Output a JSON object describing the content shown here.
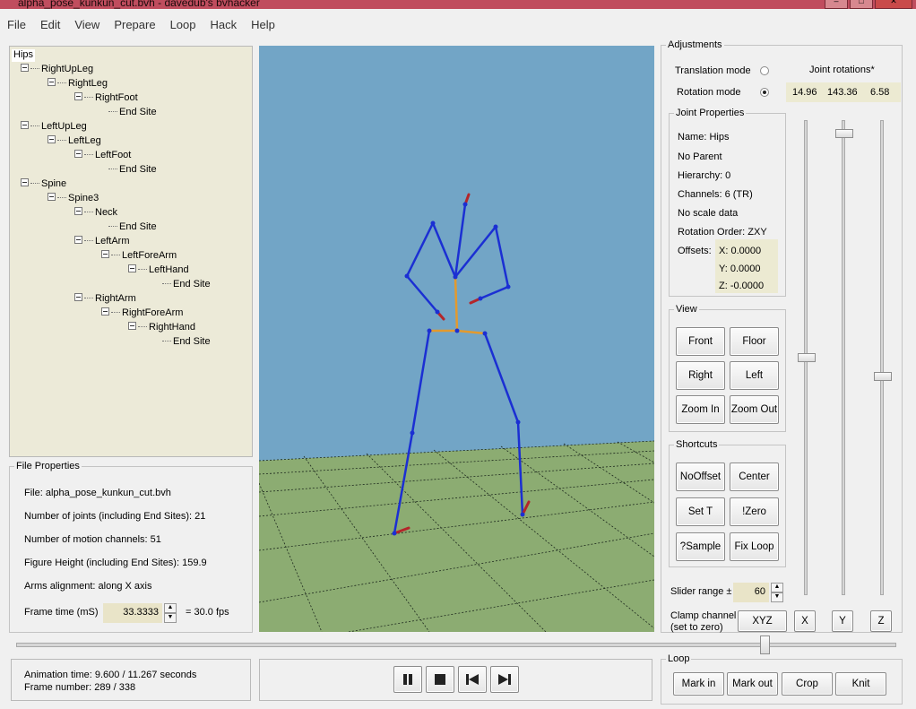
{
  "window": {
    "title": "alpha_pose_kunkun_cut.bvh - davedub's bvhacker"
  },
  "menu": [
    "File",
    "Edit",
    "View",
    "Prepare",
    "Loop",
    "Hack",
    "Help"
  ],
  "tree": [
    {
      "label": "Hips",
      "level": 0
    },
    {
      "label": "RightUpLeg",
      "level": 1
    },
    {
      "label": "RightLeg",
      "level": 2
    },
    {
      "label": "RightFoot",
      "level": 3
    },
    {
      "label": "End Site",
      "level": 4
    },
    {
      "label": "LeftUpLeg",
      "level": 1
    },
    {
      "label": "LeftLeg",
      "level": 2
    },
    {
      "label": "LeftFoot",
      "level": 3
    },
    {
      "label": "End Site",
      "level": 4
    },
    {
      "label": "Spine",
      "level": 1
    },
    {
      "label": "Spine3",
      "level": 2
    },
    {
      "label": "Neck",
      "level": 3
    },
    {
      "label": "End Site",
      "level": 4
    },
    {
      "label": "LeftArm",
      "level": 3
    },
    {
      "label": "LeftForeArm",
      "level": 4
    },
    {
      "label": "LeftHand",
      "level": 5
    },
    {
      "label": "End Site",
      "level": 6
    },
    {
      "label": "RightArm",
      "level": 3
    },
    {
      "label": "RightForeArm",
      "level": 4
    },
    {
      "label": "RightHand",
      "level": 5
    },
    {
      "label": "End Site",
      "level": 6
    }
  ],
  "file_props": {
    "legend": "File Properties",
    "file": "File: alpha_pose_kunkun_cut.bvh",
    "joints": "Number of joints (including End Sites): 21",
    "channels": "Number of motion channels: 51",
    "height": "Figure Height (including End Sites): 159.9",
    "arms": "Arms alignment: along X axis",
    "frame_time_label": "Frame time (mS)",
    "frame_time_value": "33.3333",
    "fps": "=  30.0 fps"
  },
  "adjustments": {
    "legend": "Adjustments",
    "translation_mode": "Translation mode",
    "rotation_mode": "Rotation mode",
    "joint_rotations": "Joint rotations*",
    "rot_x": "14.96",
    "rot_y": "143.36",
    "rot_z": "6.58",
    "slider_range_label": "Slider range ±",
    "slider_range_value": "60",
    "clamp_label_1": "Clamp channel",
    "clamp_label_2": "(set to zero)",
    "clamp_xyz": "XYZ",
    "clamp_x": "X",
    "clamp_y": "Y",
    "clamp_z": "Z",
    "slider_x_level": 0.5,
    "slider_y_level": 0.98,
    "slider_z_level": 0.46
  },
  "joint_props": {
    "legend": "Joint Properties",
    "name": "Name: Hips",
    "parent": "No Parent",
    "hierarchy": "Hierarchy: 0",
    "channels": "Channels: 6 (TR)",
    "scale": "No scale data",
    "order": "Rotation Order: ZXY",
    "offsets_label": "Offsets:",
    "off_x": "X:  0.0000",
    "off_y": "Y:  0.0000",
    "off_z": "Z:  -0.0000"
  },
  "view": {
    "legend": "View",
    "front": "Front",
    "floor": "Floor",
    "right": "Right",
    "left": "Left",
    "zoom_in": "Zoom In",
    "zoom_out": "Zoom Out"
  },
  "shortcuts": {
    "legend": "Shortcuts",
    "nooffset": "NoOffset",
    "center": "Center",
    "set_t": "Set T",
    "zero": "!Zero",
    "sample": "?Sample",
    "fix_loop": "Fix Loop"
  },
  "status": {
    "anim_time": "Animation time: 9.600 / 11.267 seconds",
    "frame_number": "Frame number: 289 / 338",
    "timeline_progress": 0.852
  },
  "loop": {
    "legend": "Loop",
    "mark_in": "Mark in",
    "mark_out": "Mark out",
    "crop": "Crop",
    "knit": "Knit"
  },
  "colors": {
    "sky": "#72a5c6",
    "floor": "#8cac72",
    "bone": "#1b2fd3",
    "spine": "#e39a2e",
    "end": "#b4262a",
    "panel": "#ecead8"
  }
}
